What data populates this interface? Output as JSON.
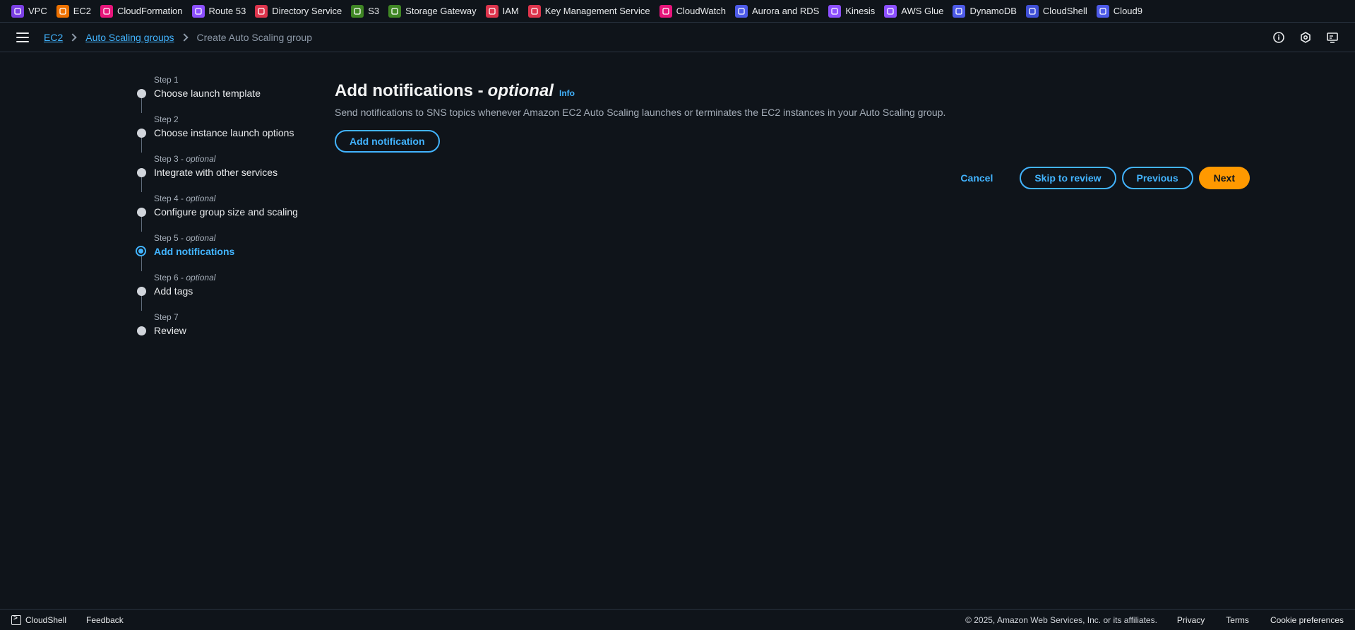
{
  "favorites": [
    {
      "label": "VPC",
      "color": "#7b3fe4",
      "icon": "vpc-icon"
    },
    {
      "label": "EC2",
      "color": "#ed7100",
      "icon": "ec2-icon"
    },
    {
      "label": "CloudFormation",
      "color": "#e7157b",
      "icon": "cloudformation-icon"
    },
    {
      "label": "Route 53",
      "color": "#8c4fff",
      "icon": "route53-icon"
    },
    {
      "label": "Directory Service",
      "color": "#dd344c",
      "icon": "directory-service-icon"
    },
    {
      "label": "S3",
      "color": "#3f8624",
      "icon": "s3-icon"
    },
    {
      "label": "Storage Gateway",
      "color": "#3f8624",
      "icon": "storage-gateway-icon"
    },
    {
      "label": "IAM",
      "color": "#dd344c",
      "icon": "iam-icon"
    },
    {
      "label": "Key Management Service",
      "color": "#dd344c",
      "icon": "kms-icon"
    },
    {
      "label": "CloudWatch",
      "color": "#e7157b",
      "icon": "cloudwatch-icon"
    },
    {
      "label": "Aurora and RDS",
      "color": "#4d5ae8",
      "icon": "rds-icon"
    },
    {
      "label": "Kinesis",
      "color": "#8c4fff",
      "icon": "kinesis-icon"
    },
    {
      "label": "AWS Glue",
      "color": "#8c4fff",
      "icon": "glue-icon"
    },
    {
      "label": "DynamoDB",
      "color": "#4d5ae8",
      "icon": "dynamodb-icon"
    },
    {
      "label": "CloudShell",
      "color": "#3f4fd6",
      "icon": "cloudshell-icon"
    },
    {
      "label": "Cloud9",
      "color": "#4d5ae8",
      "icon": "cloud9-icon"
    }
  ],
  "breadcrumb": {
    "items": [
      "EC2",
      "Auto Scaling groups"
    ],
    "current": "Create Auto Scaling group"
  },
  "steps": [
    {
      "label": "Step 1",
      "optional": "",
      "title": "Choose launch template"
    },
    {
      "label": "Step 2",
      "optional": "",
      "title": "Choose instance launch options"
    },
    {
      "label": "Step 3",
      "optional": "optional",
      "title": "Integrate with other services"
    },
    {
      "label": "Step 4",
      "optional": "optional",
      "title": "Configure group size and scaling"
    },
    {
      "label": "Step 5",
      "optional": "optional",
      "title": "Add notifications"
    },
    {
      "label": "Step 6",
      "optional": "optional",
      "title": "Add tags"
    },
    {
      "label": "Step 7",
      "optional": "",
      "title": "Review"
    }
  ],
  "active_step": 5,
  "main": {
    "title": "Add notifications -",
    "title_optional": "optional",
    "info": "Info",
    "description": "Send notifications to SNS topics whenever Amazon EC2 Auto Scaling launches or terminates the EC2 instances in your Auto Scaling group.",
    "add_button": "Add notification"
  },
  "actions": {
    "cancel": "Cancel",
    "skip": "Skip to review",
    "previous": "Previous",
    "next": "Next"
  },
  "footer": {
    "cloudshell": "CloudShell",
    "feedback": "Feedback",
    "copyright": "© 2025, Amazon Web Services, Inc. or its affiliates.",
    "privacy": "Privacy",
    "terms": "Terms",
    "cookies": "Cookie preferences"
  },
  "colors": {
    "accent": "#42b4ff",
    "primary": "#ff9900",
    "background": "#0f141a"
  }
}
